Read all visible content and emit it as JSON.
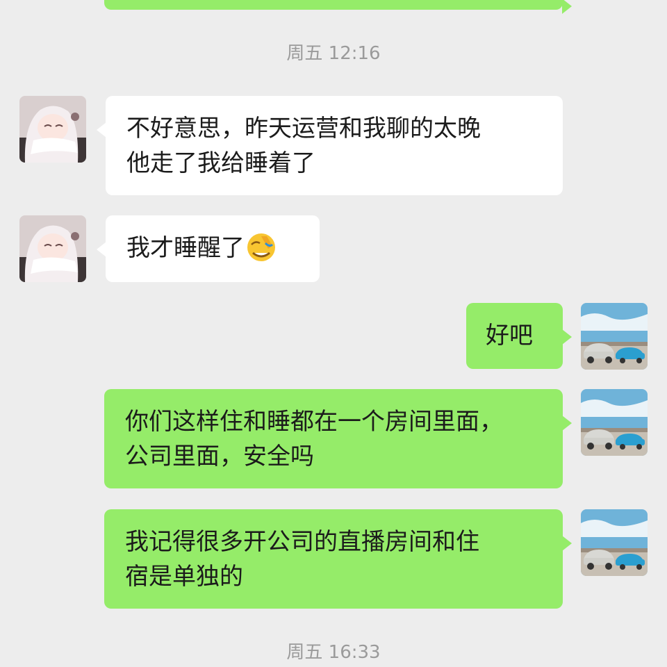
{
  "timestamps": {
    "first": "周五 12:16",
    "second": "周五 16:33"
  },
  "messages": [
    {
      "sender": "contact",
      "lines": [
        "不好意思，昨天运营和我聊的太晚",
        "他走了我给睡着了"
      ]
    },
    {
      "sender": "contact",
      "lines": [
        "我才睡醒了"
      ],
      "emoji": "facepalm-emoji"
    },
    {
      "sender": "me",
      "lines": [
        "好吧"
      ]
    },
    {
      "sender": "me",
      "lines": [
        "你们这样住和睡都在一个房间里面，",
        "公司里面，安全吗"
      ]
    },
    {
      "sender": "me",
      "lines": [
        "我记得很多开公司的直播房间和住",
        "宿是单独的"
      ]
    }
  ],
  "avatars": {
    "contact": "anime-girl-avatar",
    "me": "cars-avatar"
  },
  "colors": {
    "background": "#ededed",
    "incoming_bubble": "#ffffff",
    "outgoing_bubble": "#95ec69",
    "timestamp_text": "#9a9a9a"
  }
}
